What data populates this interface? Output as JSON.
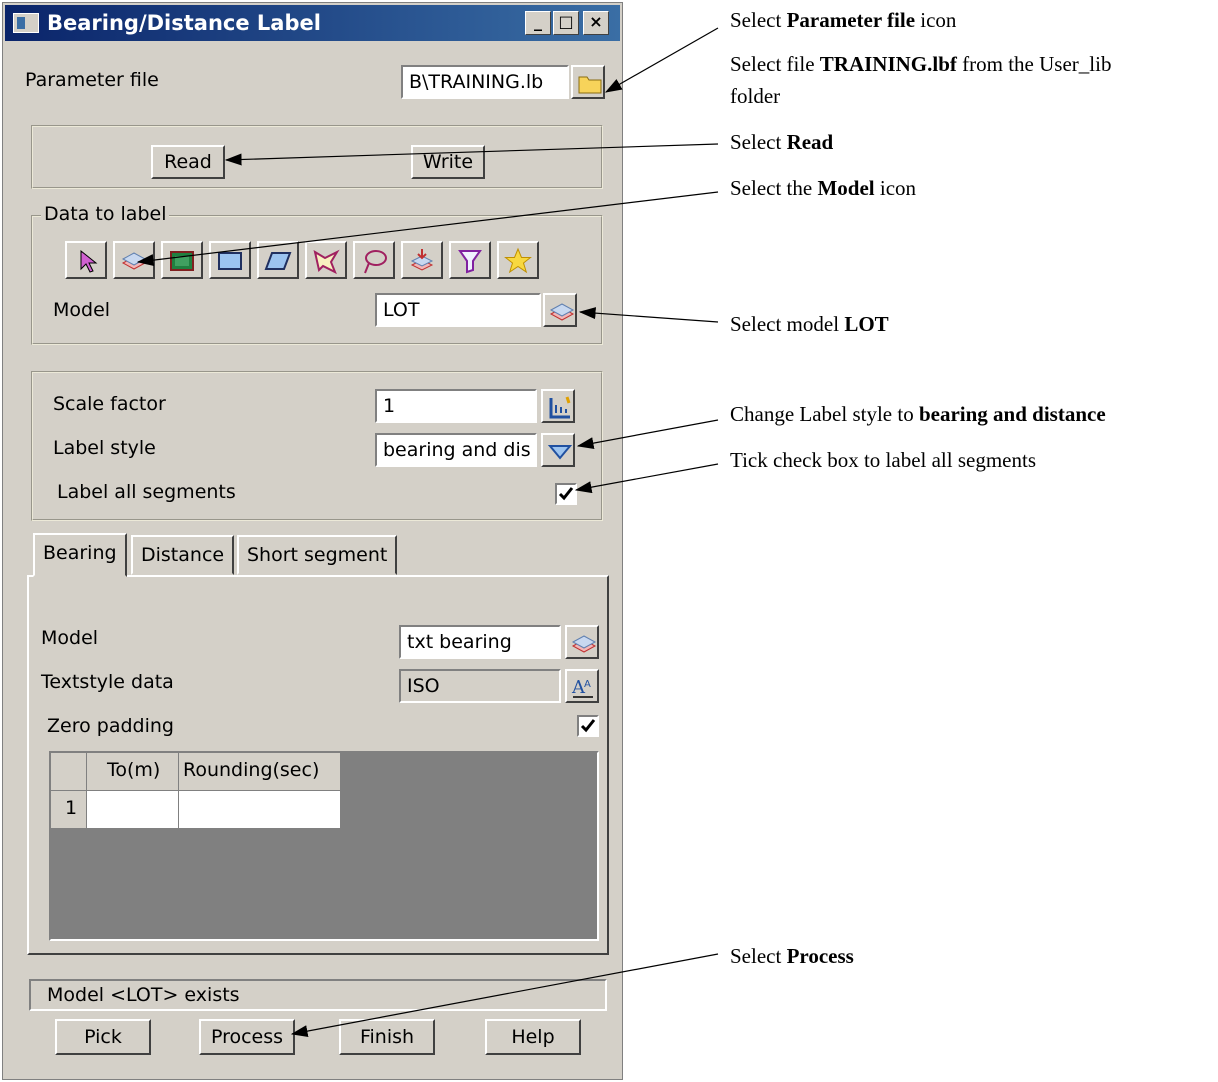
{
  "dialog": {
    "title": "Bearing/Distance Label",
    "parameter_file": {
      "label": "Parameter file",
      "value": "B\\TRAINING.lb"
    },
    "read_label": "Read",
    "write_label": "Write",
    "data_to_label": {
      "legend": "Data to label",
      "tools": [
        "pick-arrow-icon",
        "model-layers-icon",
        "view-icon",
        "rectangle-icon",
        "parallelogram-icon",
        "polygon-icon",
        "lasso-icon",
        "model-stack-icon",
        "filter-icon",
        "favourites-star-icon"
      ],
      "model_label": "Model",
      "model_value": "LOT"
    },
    "scale_factor": {
      "label": "Scale factor",
      "value": "1"
    },
    "label_style": {
      "label": "Label style",
      "value": "bearing and dis"
    },
    "label_all_segments": {
      "label": "Label all segments",
      "checked": true
    },
    "tabs": [
      "Bearing",
      "Distance",
      "Short segment"
    ],
    "bearing_tab": {
      "model_label": "Model",
      "model_value": "txt bearing",
      "textstyle_label": "Textstyle data",
      "textstyle_value": "ISO",
      "zero_padding_label": "Zero padding",
      "zero_padding_checked": true,
      "table": {
        "columns": [
          "To(m)",
          "Rounding(sec)"
        ],
        "rows": [
          {
            "index": "1",
            "cells": [
              "",
              ""
            ]
          }
        ]
      }
    },
    "status": "Model <LOT> exists",
    "buttons": {
      "pick": "Pick",
      "process": "Process",
      "finish": "Finish",
      "help": "Help"
    }
  },
  "annotations": {
    "a1": {
      "pre": "Select ",
      "bold": "Parameter file",
      "post": " icon"
    },
    "a2_line1": {
      "pre": "Select file ",
      "bold": "TRAINING.lbf",
      "post": " from the User_lib"
    },
    "a2_line2": "folder",
    "a3": {
      "pre": "Select ",
      "bold": "Read",
      "post": ""
    },
    "a4": {
      "pre": "Select the ",
      "bold": "Model",
      "post": " icon"
    },
    "a5": {
      "pre": "Select model ",
      "bold": "LOT",
      "post": ""
    },
    "a6": {
      "pre": "Change Label style to ",
      "bold": "bearing and distance",
      "post": ""
    },
    "a7": "Tick check box to label all segments",
    "a8": {
      "pre": "Select ",
      "bold": "Process",
      "post": ""
    }
  },
  "colors": {
    "face": "#d4d0c8",
    "title_start": "#0a246a",
    "title_end": "#3a6ea5",
    "table_bg": "#808080"
  }
}
